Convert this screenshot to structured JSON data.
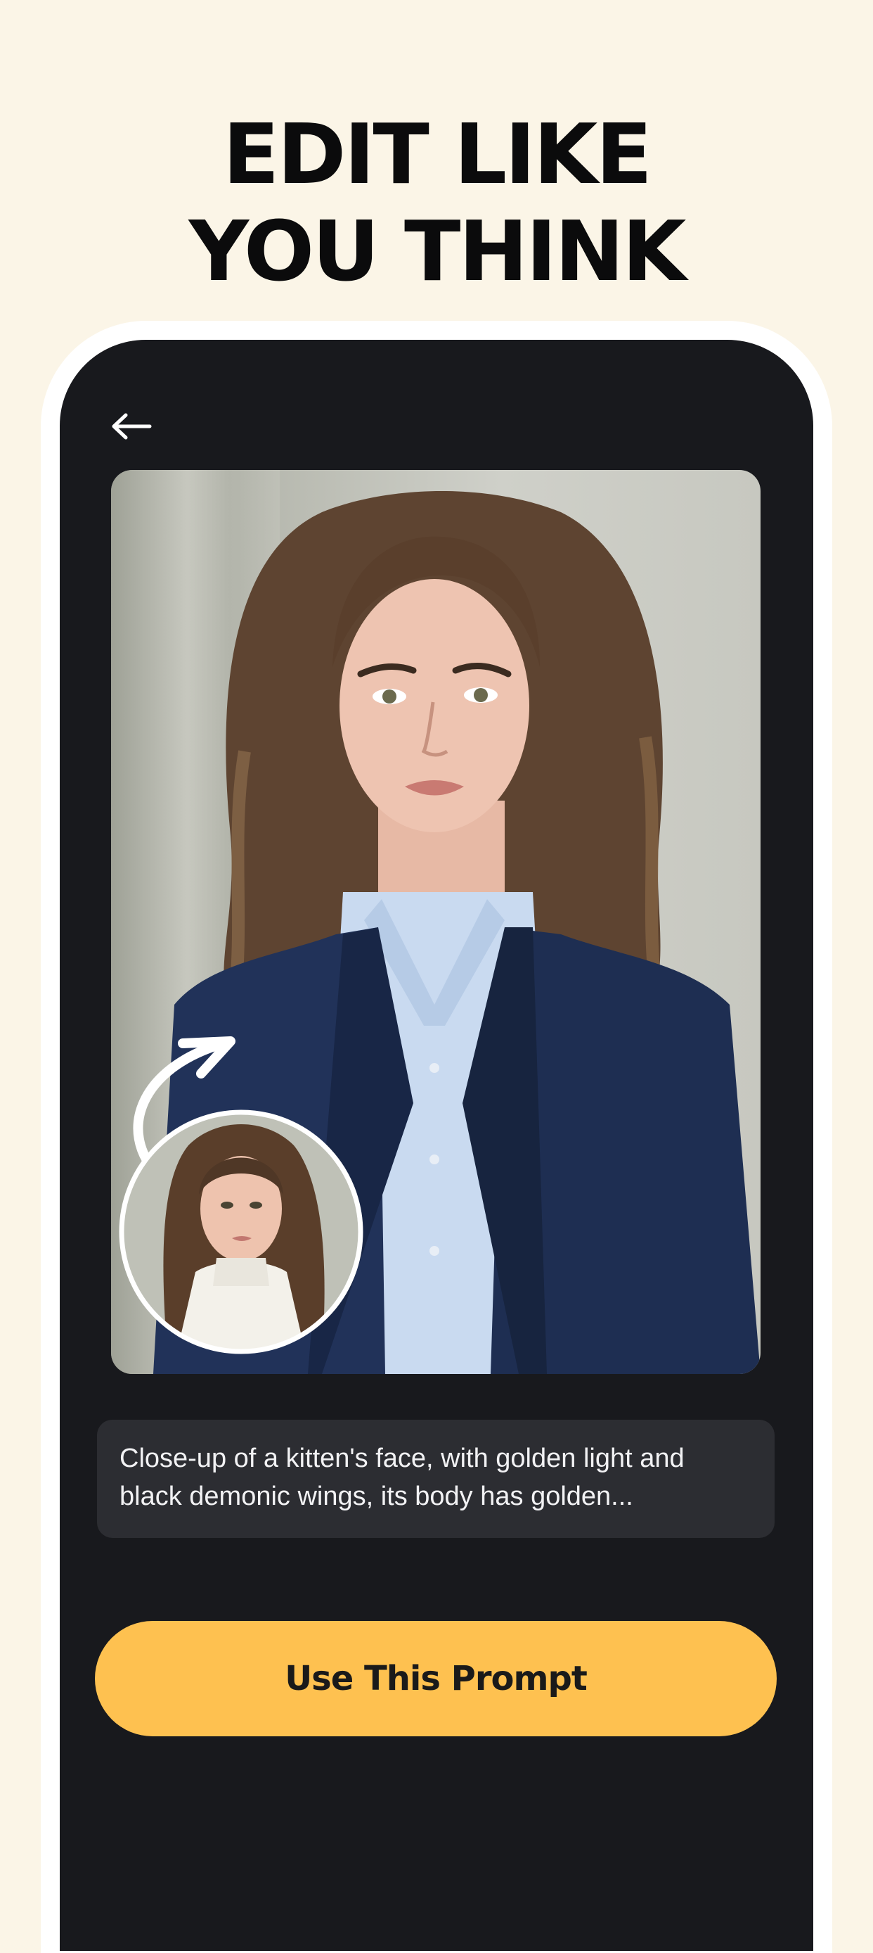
{
  "headline": {
    "line1": "EDIT LIKE",
    "line2": "YOU THINK"
  },
  "screen": {
    "back_icon": "arrow-left-icon",
    "result_image": "portrait of a woman in navy blazer and light blue shirt",
    "original_image": "portrait of a woman in white turtleneck",
    "transform_icon": "curved-arrow-icon",
    "prompt": {
      "line1": "Close-up of a kitten's face, with golden light and",
      "line2": "black demonic wings, its body has golden..."
    },
    "cta_label": "Use This Prompt"
  },
  "colors": {
    "page_background": "#fbf5e7",
    "screen_background": "#18191d",
    "prompt_background": "#2c2d32",
    "accent": "#fec150"
  }
}
